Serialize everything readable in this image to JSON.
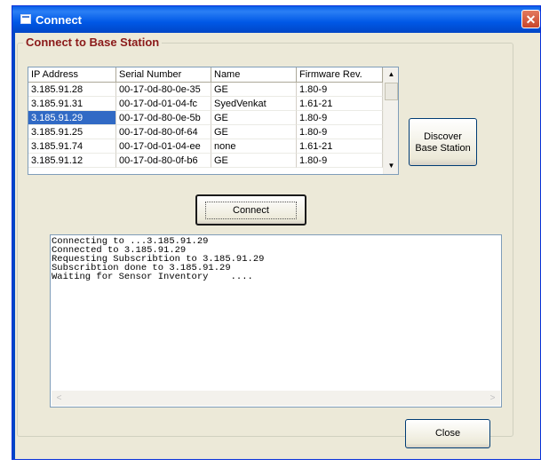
{
  "window": {
    "title": "Connect",
    "close_glyph": "✕"
  },
  "group": {
    "title": "Connect to Base Station"
  },
  "list": {
    "columns": [
      "IP Address",
      "Serial Number",
      "Name",
      "Firmware Rev."
    ],
    "rows": [
      [
        "3.185.91.28",
        "00-17-0d-80-0e-35",
        "GE",
        "1.80-9"
      ],
      [
        "3.185.91.31",
        "00-17-0d-01-04-fc",
        "SyedVenkat",
        "1.61-21"
      ],
      [
        "3.185.91.29",
        "00-17-0d-80-0e-5b",
        "GE",
        "1.80-9"
      ],
      [
        "3.185.91.25",
        "00-17-0d-80-0f-64",
        "GE",
        "1.80-9"
      ],
      [
        "3.185.91.74",
        "00-17-0d-01-04-ee",
        "none",
        "1.61-21"
      ],
      [
        "3.185.91.12",
        "00-17-0d-80-0f-b6",
        "GE",
        "1.80-9"
      ]
    ],
    "selected_row": 2
  },
  "buttons": {
    "discover_line1": "Discover",
    "discover_line2": "Base Station",
    "connect": "Connect",
    "close": "Close"
  },
  "log": {
    "lines": [
      "Connecting to ...3.185.91.29",
      "Connected to 3.185.91.29",
      "Requesting Subscribtion to 3.185.91.29",
      "Subscribtion done to 3.185.91.29",
      "Waiting for Sensor Inventory    ...."
    ]
  },
  "icons": {
    "scroll_up": "▲",
    "scroll_down": "▼",
    "scroll_left": "<",
    "scroll_right": ">"
  }
}
